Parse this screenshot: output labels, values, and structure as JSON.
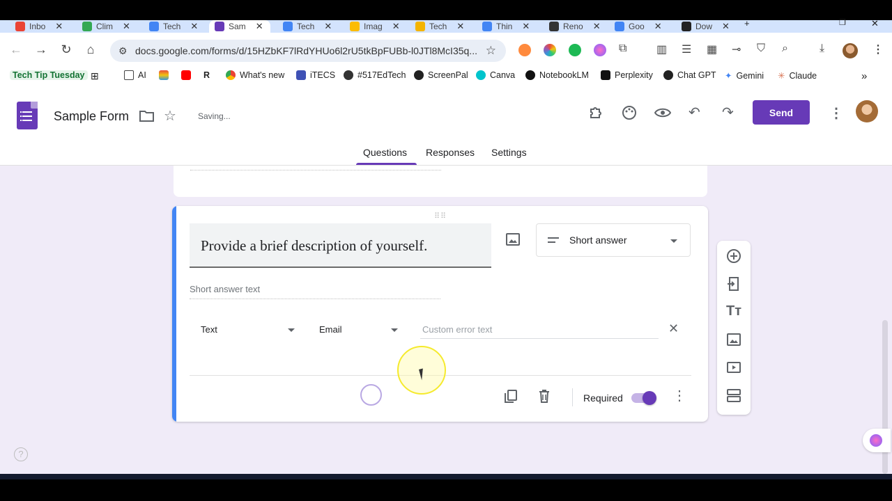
{
  "browser": {
    "tabs": [
      {
        "label": "Inbo",
        "color": "#ea4335"
      },
      {
        "label": "Clim",
        "color": "#34a853"
      },
      {
        "label": "Tech",
        "color": "#4285f4"
      },
      {
        "label": "Sam",
        "color": "#673ab7",
        "active": true
      },
      {
        "label": "Tech",
        "color": "#4285f4"
      },
      {
        "label": "Imag",
        "color": "#fbbc04"
      },
      {
        "label": "Tech",
        "color": "#f4b400"
      },
      {
        "label": "Thin",
        "color": "#4285f4"
      },
      {
        "label": "Reno",
        "color": "#333333"
      },
      {
        "label": "Goo",
        "color": "#4285f4"
      },
      {
        "label": "Dow",
        "color": "#222222"
      }
    ],
    "url": "docs.google.com/forms/d/15HZbKF7lRdYHUo6l2rU5tkBpFUBb-l0JTl8McI35q...",
    "bookmarks": [
      {
        "label": "Tech Tip Tuesday"
      },
      {
        "label": "AI"
      },
      {
        "label": "What's new"
      },
      {
        "label": "iTECS"
      },
      {
        "label": "#517EdTech"
      },
      {
        "label": "ScreenPal"
      },
      {
        "label": "Canva"
      },
      {
        "label": "NotebookLM"
      },
      {
        "label": "Perplexity"
      },
      {
        "label": "Chat GPT"
      },
      {
        "label": "Gemini"
      },
      {
        "label": "Claude"
      }
    ]
  },
  "form": {
    "title": "Sample Form",
    "status": "Saving...",
    "send_label": "Send",
    "tabs": {
      "questions": "Questions",
      "responses": "Responses",
      "settings": "Settings"
    },
    "accent": "#673ab7"
  },
  "question": {
    "title": "Provide a brief description of yourself.",
    "type": "Short answer",
    "answer_placeholder": "Short answer text",
    "validation_type": "Text",
    "validation_rule": "Email",
    "error_placeholder": "Custom error text",
    "required_label": "Required",
    "required": true
  }
}
